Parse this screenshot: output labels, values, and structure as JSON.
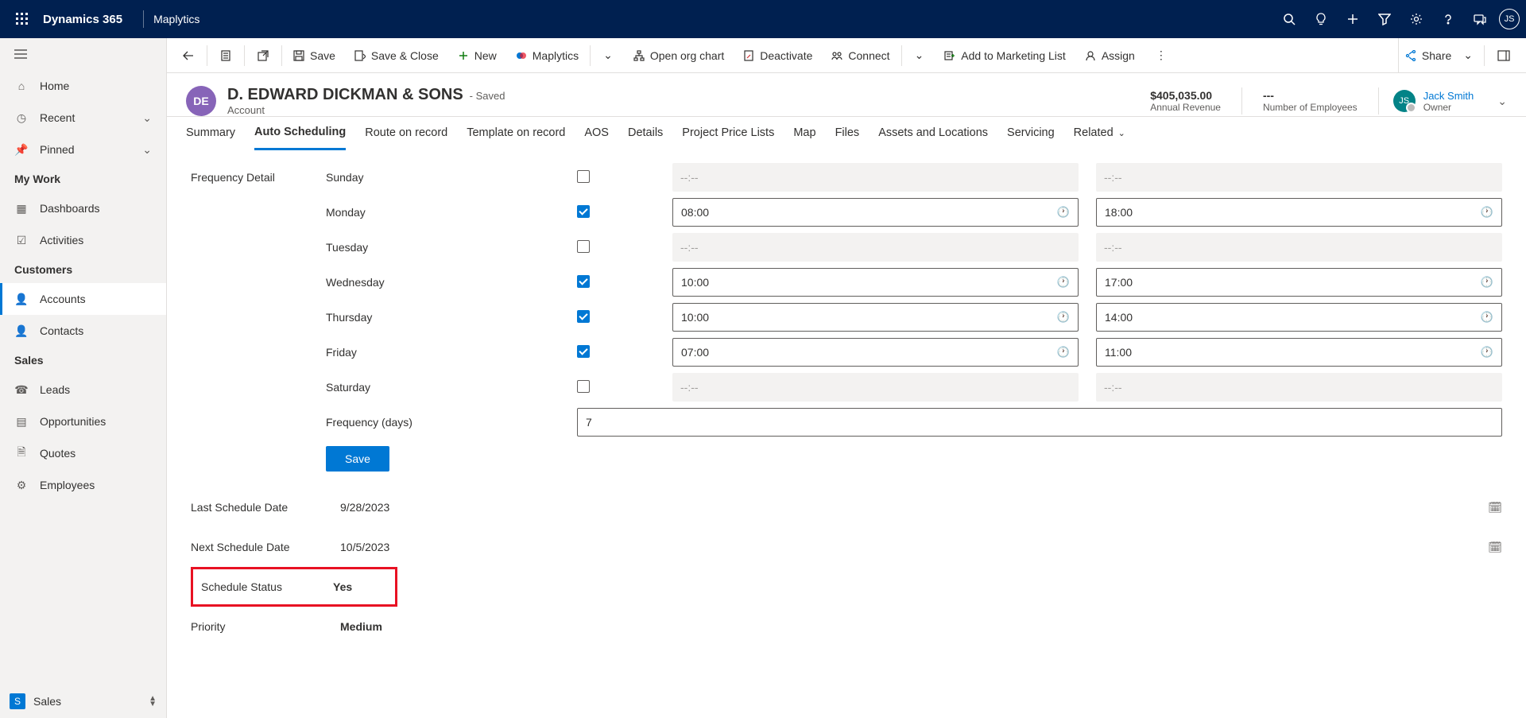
{
  "topnav": {
    "brand": "Dynamics 365",
    "app": "Maplytics",
    "avatar_initials": "JS"
  },
  "sidebar": {
    "items": [
      {
        "label": "Home"
      },
      {
        "label": "Recent"
      },
      {
        "label": "Pinned"
      }
    ],
    "groups": {
      "my_work": "My Work",
      "customers": "Customers",
      "sales": "Sales"
    },
    "my_work": [
      {
        "label": "Dashboards"
      },
      {
        "label": "Activities"
      }
    ],
    "customers": [
      {
        "label": "Accounts"
      },
      {
        "label": "Contacts"
      }
    ],
    "sales": [
      {
        "label": "Leads"
      },
      {
        "label": "Opportunities"
      },
      {
        "label": "Quotes"
      },
      {
        "label": "Employees"
      }
    ],
    "bottom": {
      "badge": "S",
      "label": "Sales"
    }
  },
  "commands": {
    "save": "Save",
    "save_close": "Save & Close",
    "new": "New",
    "maplytics": "Maplytics",
    "open_org": "Open org chart",
    "deactivate": "Deactivate",
    "connect": "Connect",
    "marketing": "Add to Marketing List",
    "assign": "Assign",
    "share": "Share"
  },
  "record": {
    "badge": "DE",
    "title": "D. EDWARD DICKMAN & SONS",
    "saved_suffix": "- Saved",
    "subtitle": "Account",
    "revenue_value": "$405,035.00",
    "revenue_label": "Annual Revenue",
    "employees_value": "---",
    "employees_label": "Number of Employees",
    "owner_initials": "JS",
    "owner_name": "Jack Smith",
    "owner_role": "Owner"
  },
  "tabs": [
    "Summary",
    "Auto Scheduling",
    "Route on record",
    "Template on record",
    "AOS",
    "Details",
    "Project Price Lists",
    "Map",
    "Files",
    "Assets and Locations",
    "Servicing",
    "Related"
  ],
  "form": {
    "section_label": "Frequency Detail",
    "days": [
      {
        "name": "Sunday",
        "checked": false,
        "start": "--:--",
        "end": "--:--"
      },
      {
        "name": "Monday",
        "checked": true,
        "start": "08:00",
        "end": "18:00"
      },
      {
        "name": "Tuesday",
        "checked": false,
        "start": "--:--",
        "end": "--:--"
      },
      {
        "name": "Wednesday",
        "checked": true,
        "start": "10:00",
        "end": "17:00"
      },
      {
        "name": "Thursday",
        "checked": true,
        "start": "10:00",
        "end": "14:00"
      },
      {
        "name": "Friday",
        "checked": true,
        "start": "07:00",
        "end": "11:00"
      },
      {
        "name": "Saturday",
        "checked": false,
        "start": "--:--",
        "end": "--:--"
      }
    ],
    "frequency_label": "Frequency (days)",
    "frequency_value": "7",
    "save_btn": "Save",
    "last_date_label": "Last Schedule Date",
    "last_date_value": "9/28/2023",
    "next_date_label": "Next Schedule Date",
    "next_date_value": "10/5/2023",
    "status_label": "Schedule Status",
    "status_value": "Yes",
    "priority_label": "Priority",
    "priority_value": "Medium"
  }
}
